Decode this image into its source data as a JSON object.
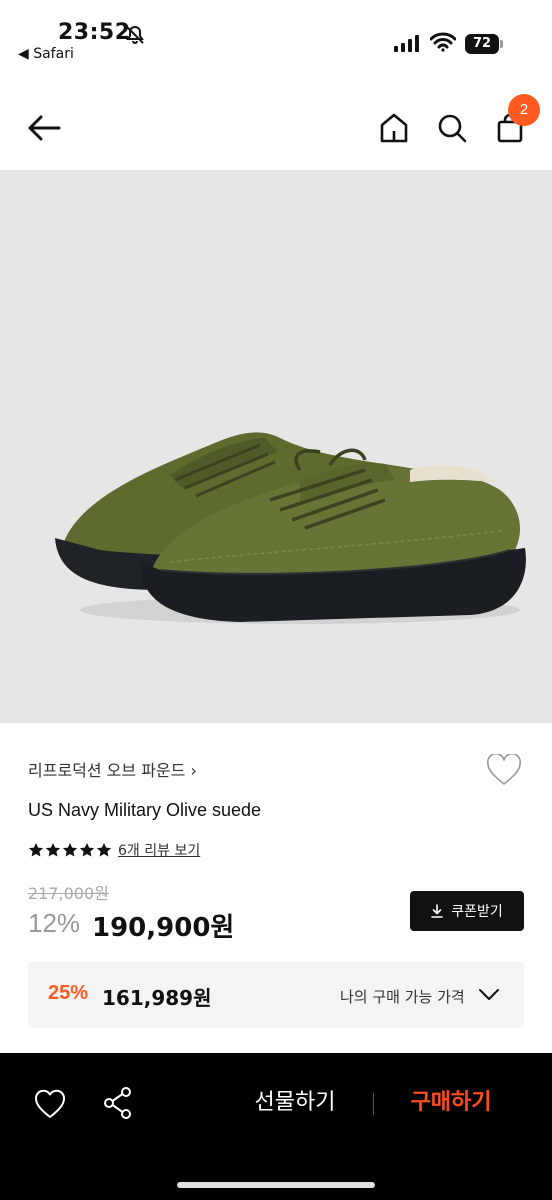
{
  "status_bar": {
    "time": "23:52",
    "back_app": "◀ Safari",
    "battery": "72"
  },
  "nav": {
    "cart_count": "2"
  },
  "product": {
    "brand": "리프로덕션 오브 파운드 ›",
    "name": "US Navy Military Olive suede",
    "rating_stars": 5,
    "review_link": "6개 리뷰 보기",
    "original_price": "217,000원",
    "discount_rate": "12%",
    "sale_price": "190,900원",
    "coupon_label": "쿠폰받기",
    "member_rate": "25%",
    "member_price": "161,989원",
    "member_label": "나의 구매 가능 가격"
  },
  "bottom_bar": {
    "gift_label": "선물하기",
    "buy_label": "구매하기"
  },
  "colors": {
    "accent": "#ff5a1f",
    "buy": "#ff4b1f",
    "image_bg": "#e6e6e6"
  },
  "icons": [
    "bell-slash-icon",
    "signal-icon",
    "wifi-icon",
    "battery-icon",
    "back-arrow-icon",
    "home-icon",
    "search-icon",
    "cart-icon",
    "heart-icon",
    "star-icon",
    "download-icon",
    "chevron-down-icon",
    "share-icon"
  ]
}
